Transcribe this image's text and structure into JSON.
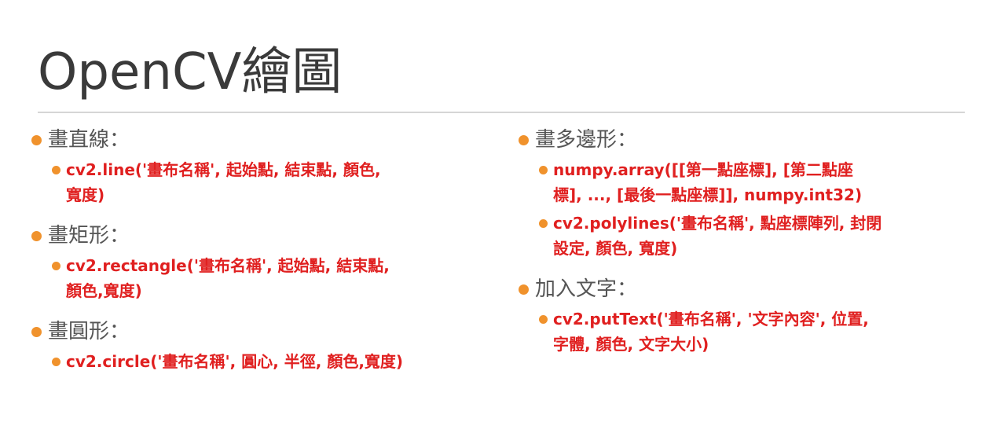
{
  "title": "OpenCV繪圖",
  "colors": {
    "bullet": "#f0922c",
    "code_text": "#e02020",
    "heading_text": "#555555",
    "title_text": "#3a3a3a"
  },
  "left_sections": [
    {
      "heading": "畫直線：",
      "items": [
        {
          "line1": "cv2.line('畫布名稱', 起始點, 結束點, 顏色,",
          "line2": "寬度)"
        }
      ]
    },
    {
      "heading": "畫矩形：",
      "items": [
        {
          "line1": "cv2.rectangle('畫布名稱', 起始點, 結束點,",
          "line2": "顏色,寬度)"
        }
      ]
    },
    {
      "heading": "畫圓形：",
      "items": [
        {
          "line1": "cv2.circle('畫布名稱', 圓心, 半徑, 顏色,寬度)",
          "line2": ""
        }
      ]
    }
  ],
  "right_sections": [
    {
      "heading": "畫多邊形：",
      "items": [
        {
          "line1": "numpy.array([[第一點座標], [第二點座",
          "line2": "標], ..., [最後一點座標]], numpy.int32)"
        },
        {
          "line1": "cv2.polylines('畫布名稱', 點座標陣列, 封閉",
          "line2": "設定, 顏色, 寬度)"
        }
      ]
    },
    {
      "heading": "加入文字：",
      "items": [
        {
          "line1": "cv2.putText('畫布名稱', '文字內容', 位置,",
          "line2": "字體, 顏色, 文字大小)"
        }
      ]
    }
  ]
}
